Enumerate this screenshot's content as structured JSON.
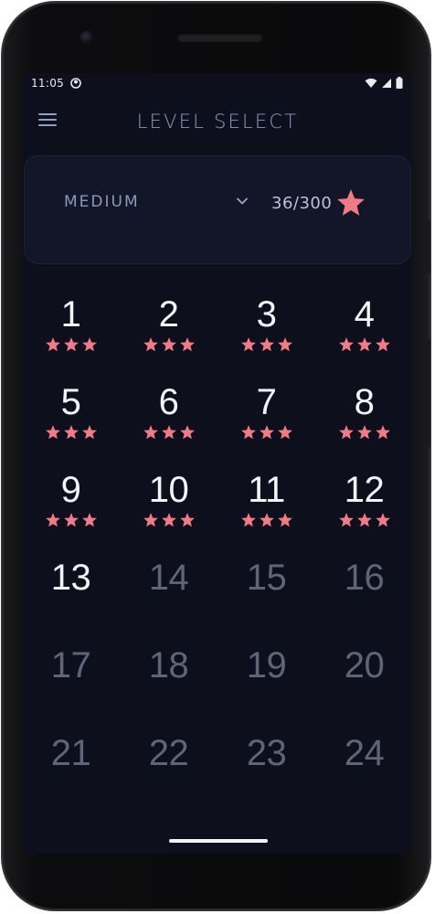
{
  "status_bar": {
    "time": "11:05"
  },
  "app_bar": {
    "title": "LEVEL SELECT"
  },
  "selector": {
    "difficulty": "MEDIUM",
    "stars_earned": "36/300"
  },
  "colors": {
    "star": "#f07a86",
    "background": "#0e0f1d",
    "card": "#131628",
    "accent_text": "#8d9ac0"
  },
  "levels": [
    {
      "number": "1",
      "stars": 3,
      "locked": false
    },
    {
      "number": "2",
      "stars": 3,
      "locked": false
    },
    {
      "number": "3",
      "stars": 3,
      "locked": false
    },
    {
      "number": "4",
      "stars": 3,
      "locked": false
    },
    {
      "number": "5",
      "stars": 3,
      "locked": false
    },
    {
      "number": "6",
      "stars": 3,
      "locked": false
    },
    {
      "number": "7",
      "stars": 3,
      "locked": false
    },
    {
      "number": "8",
      "stars": 3,
      "locked": false
    },
    {
      "number": "9",
      "stars": 3,
      "locked": false
    },
    {
      "number": "10",
      "stars": 3,
      "locked": false
    },
    {
      "number": "11",
      "stars": 3,
      "locked": false
    },
    {
      "number": "12",
      "stars": 3,
      "locked": false
    },
    {
      "number": "13",
      "stars": 0,
      "locked": false
    },
    {
      "number": "14",
      "stars": 0,
      "locked": true
    },
    {
      "number": "15",
      "stars": 0,
      "locked": true
    },
    {
      "number": "16",
      "stars": 0,
      "locked": true
    },
    {
      "number": "17",
      "stars": 0,
      "locked": true
    },
    {
      "number": "18",
      "stars": 0,
      "locked": true
    },
    {
      "number": "19",
      "stars": 0,
      "locked": true
    },
    {
      "number": "20",
      "stars": 0,
      "locked": true
    },
    {
      "number": "21",
      "stars": 0,
      "locked": true
    },
    {
      "number": "22",
      "stars": 0,
      "locked": true
    },
    {
      "number": "23",
      "stars": 0,
      "locked": true
    },
    {
      "number": "24",
      "stars": 0,
      "locked": true
    }
  ]
}
